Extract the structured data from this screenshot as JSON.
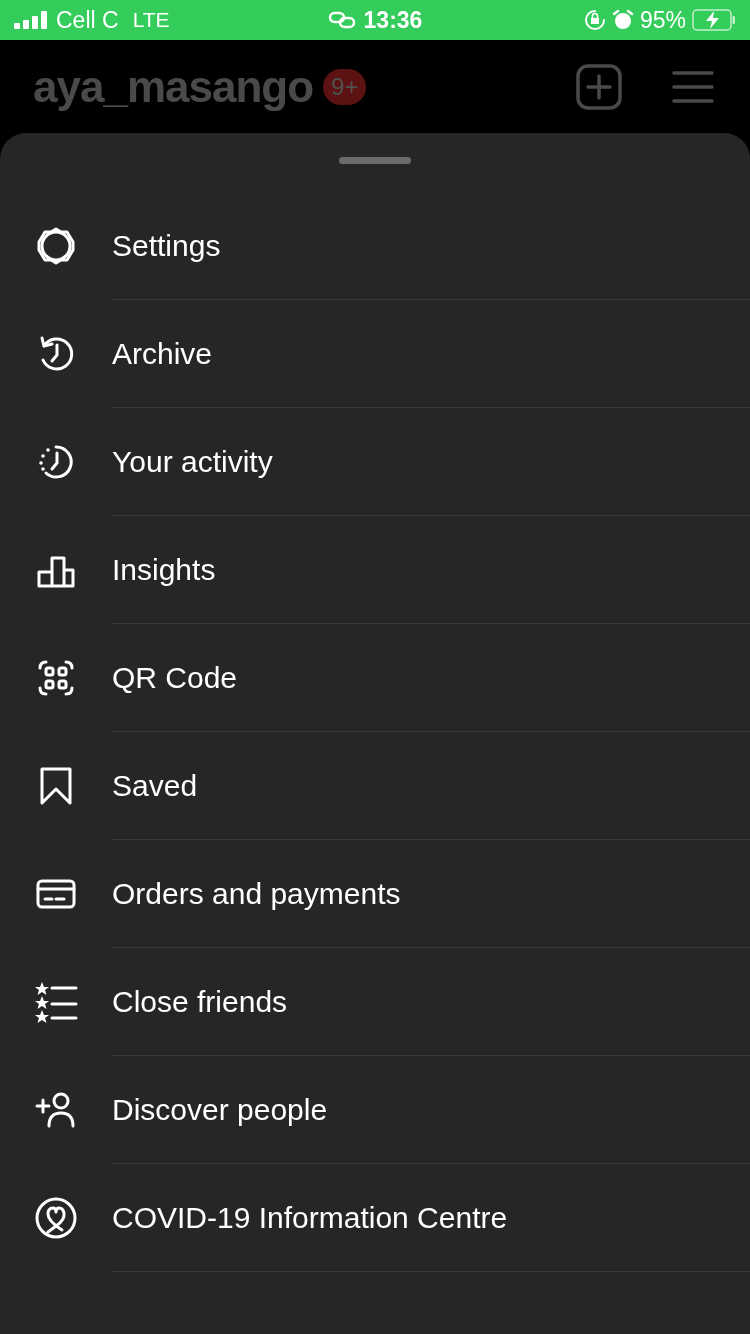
{
  "status_bar": {
    "carrier": "Cell C",
    "network": "LTE",
    "time": "13:36",
    "battery": "95%"
  },
  "header": {
    "username": "aya_masango",
    "badge": "9+"
  },
  "menu": [
    {
      "kind": "settings",
      "label": "Settings"
    },
    {
      "kind": "archive",
      "label": "Archive"
    },
    {
      "kind": "activity",
      "label": "Your activity"
    },
    {
      "kind": "insights",
      "label": "Insights"
    },
    {
      "kind": "qr",
      "label": "QR Code"
    },
    {
      "kind": "saved",
      "label": "Saved"
    },
    {
      "kind": "card",
      "label": "Orders and payments"
    },
    {
      "kind": "friends",
      "label": "Close friends"
    },
    {
      "kind": "discover",
      "label": "Discover people"
    },
    {
      "kind": "covid",
      "label": "COVID-19 Information Centre"
    }
  ]
}
